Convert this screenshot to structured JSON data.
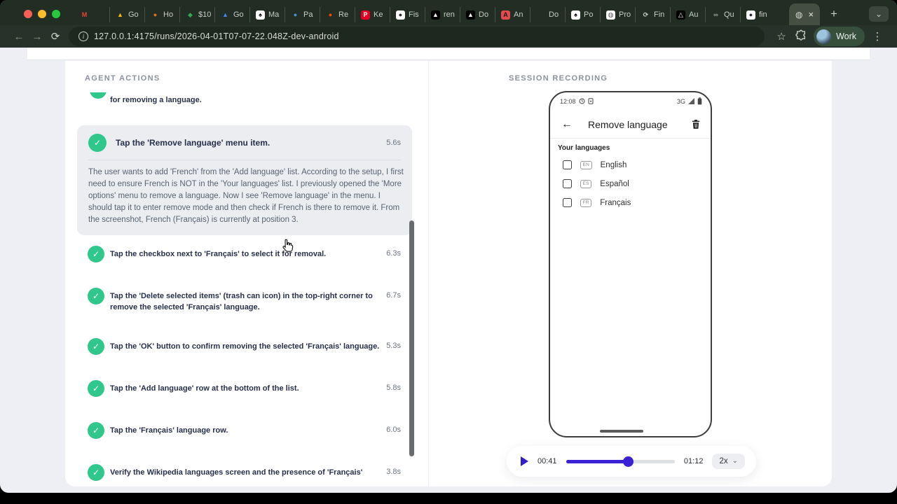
{
  "glyphs": {
    "back": "←",
    "forward": "→",
    "reload": "⟳",
    "star": "☆",
    "more_vertical": "⋮",
    "close": "×",
    "plus": "+",
    "chevron_down": "⌄",
    "info": "i",
    "globe": "◍",
    "check": "✓"
  },
  "browser": {
    "url": "127.0.0.1:4175/runs/2026-04-01T07-07-22.048Z-dev-android",
    "profile_label": "Work",
    "tabs": [
      {
        "label": "",
        "glyph": "M",
        "fg": "#ea4335",
        "bg": "transparent"
      },
      {
        "label": "Go",
        "glyph": "▲",
        "fg": "#fbbc04",
        "bg": "transparent"
      },
      {
        "label": "Ho",
        "glyph": "●",
        "fg": "#e8710a",
        "bg": "transparent"
      },
      {
        "label": "$10",
        "glyph": "◆",
        "fg": "#34a853",
        "bg": "transparent"
      },
      {
        "label": "Go",
        "glyph": "▲",
        "fg": "#4285f4",
        "bg": "transparent"
      },
      {
        "label": "Ma",
        "glyph": "♠",
        "fg": "#111111",
        "bg": "#ffffff"
      },
      {
        "label": "Pa",
        "glyph": "●",
        "fg": "#4a90d9",
        "bg": "transparent"
      },
      {
        "label": "Re",
        "glyph": "●",
        "fg": "#ff4500",
        "bg": "transparent"
      },
      {
        "label": "Ke",
        "glyph": "P",
        "fg": "#ffffff",
        "bg": "#e60023"
      },
      {
        "label": "Fis",
        "glyph": "●",
        "fg": "#24292f",
        "bg": "#ffffff"
      },
      {
        "label": "ren",
        "glyph": "▲",
        "fg": "#ffffff",
        "bg": "#000000"
      },
      {
        "label": "Do",
        "glyph": "▲",
        "fg": "#ffffff",
        "bg": "#000000"
      },
      {
        "label": "An",
        "glyph": "A",
        "fg": "#1a1a1a",
        "bg": "#e5484d"
      },
      {
        "label": "Do",
        "glyph": "",
        "fg": "#cfd6cf",
        "bg": "transparent"
      },
      {
        "label": "Po",
        "glyph": "♠",
        "fg": "#111111",
        "bg": "#ffffff"
      },
      {
        "label": "Pro",
        "glyph": "◍",
        "fg": "#555555",
        "bg": "#ffffff"
      },
      {
        "label": "Fin",
        "glyph": "⟳",
        "fg": "#cfd6cf",
        "bg": "transparent"
      },
      {
        "label": "Au",
        "glyph": "△",
        "fg": "#ffffff",
        "bg": "#000000"
      },
      {
        "label": "Qu",
        "glyph": "∞",
        "fg": "#9aa59a",
        "bg": "transparent"
      },
      {
        "label": "fin",
        "glyph": "●",
        "fg": "#24292f",
        "bg": "#ffffff"
      }
    ]
  },
  "left_panel": {
    "header": "AGENT ACTIONS",
    "partial_item": {
      "title": "for removing a language."
    },
    "expanded_item": {
      "title": "Tap the 'Remove language' menu item.",
      "duration": "5.6s",
      "body": "The user wants to add 'French' from the 'Add language' list. According to the setup, I first need to ensure French is NOT in the 'Your languages' list. I previously opened the 'More options' menu to remove a language. Now I see 'Remove language' in the menu. I should tap it to enter remove mode and then check if French is there to remove it. From the screenshot, French (Français) is currently at position 3."
    },
    "items": [
      {
        "title": "Tap the checkbox next to 'Français' to select it for removal.",
        "duration": "6.3s"
      },
      {
        "title": "Tap the 'Delete selected items' (trash can icon) in the top-right corner to remove the selected 'Français' language.",
        "duration": "6.7s"
      },
      {
        "title": "Tap the 'OK' button to confirm removing the selected 'Français' language.",
        "duration": "5.3s"
      },
      {
        "title": "Tap the 'Add language' row at the bottom of the list.",
        "duration": "5.8s"
      },
      {
        "title": "Tap the 'Français' language row.",
        "duration": "6.0s"
      },
      {
        "title": "Verify the Wikipedia languages screen and the presence of 'Français'",
        "duration": "3.8s"
      }
    ]
  },
  "right_panel": {
    "header": "SESSION RECORDING",
    "phone": {
      "status": {
        "time": "12:08",
        "network": "3G"
      },
      "app_bar": {
        "title": "Remove language"
      },
      "section_label": "Your languages",
      "languages": [
        {
          "code": "EN",
          "name": "English"
        },
        {
          "code": "ES",
          "name": "Español"
        },
        {
          "code": "FR",
          "name": "Français"
        }
      ]
    },
    "player": {
      "current": "00:41",
      "total": "01:12",
      "speed": "2x",
      "progress_pct": 57
    }
  },
  "colors": {
    "accent_green": "#30c88a",
    "accent_indigo": "#3a22d4",
    "chrome_bg": "#27332a",
    "tabstrip_bg": "#222d23",
    "active_tab_bg": "#454f41",
    "page_bg": "#edeff4",
    "expanded_card_bg": "#ebedf1",
    "title_text": "#27304b"
  }
}
